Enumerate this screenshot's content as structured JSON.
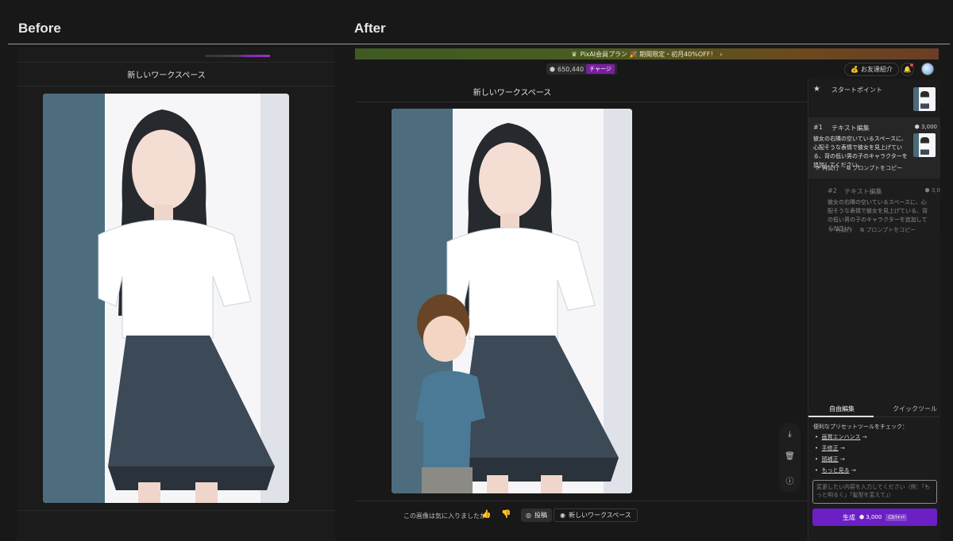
{
  "headings": {
    "before": "Before",
    "after": "After"
  },
  "before_panel": {
    "workspace_title": "新しいワークスペース"
  },
  "after_panel": {
    "promo_banner": {
      "crown": "♛",
      "text": "PixAI会員プラン 🎉 期間限定・初月40%OFF！",
      "chevron": "›"
    },
    "credits": {
      "icon": "⬢",
      "amount": "650,440",
      "charge_label": "チャージ"
    },
    "friend_button": {
      "icon": "💰",
      "label": "お友達紹介"
    },
    "bell_icon": "🔔",
    "workspace_title": "新しいワークスペース",
    "side_tools": {
      "download": "⤓",
      "delete": "🗑",
      "info": "ⓘ"
    },
    "feedback": {
      "question": "この画像は気に入りましたか？",
      "like": "👍",
      "dislike": "👎",
      "post_icon": "◎",
      "post_label": "投稿",
      "new_ws_icon": "◉",
      "new_ws_label": "新しいワークスペース"
    }
  },
  "sidebar": {
    "start_point": {
      "icon": "★",
      "label": "スタートポイント"
    },
    "steps": [
      {
        "number": "#1",
        "name": "テキスト編集",
        "cost": "⬢ 3,000",
        "text": "彼女の右隣の空いているスペースに、心配そうな表情で彼女を見上げている、背の低い男の子のキャラクターを追加してください。",
        "retry": "⟳ 再試行",
        "copy": "⧉ プロンプトをコピー"
      },
      {
        "number": "#2",
        "name": "テキスト編集",
        "cost": "⬢ 3,0",
        "text": "彼女の右隣の空いているスペースに、心配そうな表情で彼女を見上げている、背の低い男の子のキャラクターを追加してください。",
        "retry": "⟳ 再試行",
        "copy": "⧉ プロンプトをコピー"
      }
    ],
    "tabs": {
      "free_edit": "自由編集",
      "quick_tool": "クイックツール"
    },
    "presets_title": "便利なプリセットツールをチェック：",
    "presets": [
      {
        "name": "画質エンハンス",
        "arrow": "→"
      },
      {
        "name": "手修正",
        "arrow": "→"
      },
      {
        "name": "顔補正",
        "arrow": "→"
      },
      {
        "name": "もっと見る",
        "arrow": "→"
      }
    ],
    "prompt_placeholder": "変更したい内容を入力してください（例：「もっと明るく」「髪型を変えて」）",
    "generate": {
      "label": "生成",
      "cost": "⬢ 3,000",
      "shortcut": "Ctrl+⏎"
    }
  },
  "colors": {
    "accent_purple": "#6c1fc4",
    "charge_purple": "#7b1fa2",
    "background": "#181818"
  }
}
